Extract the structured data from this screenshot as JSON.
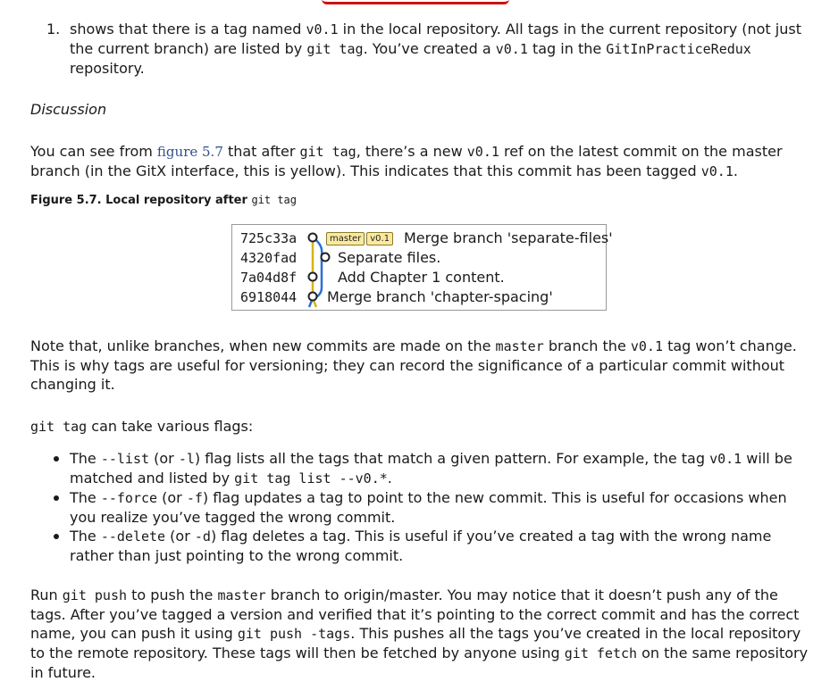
{
  "list_item": {
    "number": "1.",
    "parts": [
      {
        "t": "shows that there is a tag named "
      },
      {
        "c": "v0.1"
      },
      {
        "t": " in the local repository. All tags in the current repository (not just the current branch) are listed by "
      },
      {
        "c": "git tag"
      },
      {
        "t": ". You’ve created a "
      },
      {
        "c": "v0.1"
      },
      {
        "t": " tag in the "
      },
      {
        "c": "GitInPracticeRedux"
      },
      {
        "t": " repository."
      }
    ]
  },
  "discussion_heading": "Discussion",
  "para1": [
    {
      "t": "You can see from "
    },
    {
      "l": "figure 5.7"
    },
    {
      "t": " that after "
    },
    {
      "c": "git tag"
    },
    {
      "t": ", there’s a new "
    },
    {
      "c": "v0.1"
    },
    {
      "t": " ref on the latest commit on the master branch (in the GitX interface, this is yellow). This indicates that this commit has been tagged "
    },
    {
      "c": "v0.1"
    },
    {
      "t": "."
    }
  ],
  "figure_caption": {
    "label": "Figure 5.7. Local repository after ",
    "code": "git tag"
  },
  "figure": {
    "commits": [
      {
        "hash": "725c33a",
        "message": "Merge branch 'separate-files'",
        "badges": [
          "master",
          "v0.1"
        ]
      },
      {
        "hash": "4320fad",
        "message": "Separate files.",
        "badges": []
      },
      {
        "hash": "7a04d8f",
        "message": "Add Chapter 1 content.",
        "badges": []
      },
      {
        "hash": "6918044",
        "message": "Merge branch 'chapter-spacing'",
        "badges": []
      }
    ],
    "colors": {
      "badge_fill": "#fbe9a0",
      "lane_blue": "#2a6fd6",
      "lane_gold": "#d8b21a",
      "node": "#222222"
    }
  },
  "para2": [
    {
      "t": "Note that, unlike branches, when new commits are made on the "
    },
    {
      "c": "master"
    },
    {
      "t": " branch the "
    },
    {
      "c": "v0.1"
    },
    {
      "t": " tag won’t change. This is why tags are useful for versioning; they can record the significance of a particular commit without changing it."
    }
  ],
  "para3": [
    {
      "c": "git tag"
    },
    {
      "t": " can take various flags:"
    }
  ],
  "bullets": [
    [
      {
        "t": "The "
      },
      {
        "c": "--list"
      },
      {
        "t": " (or "
      },
      {
        "c": "-l"
      },
      {
        "t": ") flag lists all the tags that match a given pattern. For example, the tag "
      },
      {
        "c": "v0.1"
      },
      {
        "t": " will be matched and listed by "
      },
      {
        "c": "git tag list --v0.*"
      },
      {
        "t": "."
      }
    ],
    [
      {
        "t": "The "
      },
      {
        "c": "--force"
      },
      {
        "t": " (or "
      },
      {
        "c": "-f"
      },
      {
        "t": ") flag updates a tag to point to the new commit. This is useful for occasions when you realize you’ve tagged the wrong commit."
      }
    ],
    [
      {
        "t": "The "
      },
      {
        "c": "--delete"
      },
      {
        "t": " (or "
      },
      {
        "c": "-d"
      },
      {
        "t": ") flag deletes a tag. This is useful if you’ve created a tag with the wrong name rather than just pointing to the wrong commit."
      }
    ]
  ],
  "para4": [
    {
      "t": "Run "
    },
    {
      "c": "git push"
    },
    {
      "t": " to push the "
    },
    {
      "c": "master"
    },
    {
      "t": " branch to origin/master. You may notice that it doesn’t push any of the tags. After you’ve tagged a version and verified that it’s pointing to the correct commit and has the correct name, you can push it using "
    },
    {
      "c": "git push -tags"
    },
    {
      "t": ". This pushes all the tags you’ve created in the local repository to the remote repository. These tags will then be fetched by anyone using "
    },
    {
      "c": "git fetch"
    },
    {
      "t": " on the same repository in future."
    }
  ]
}
